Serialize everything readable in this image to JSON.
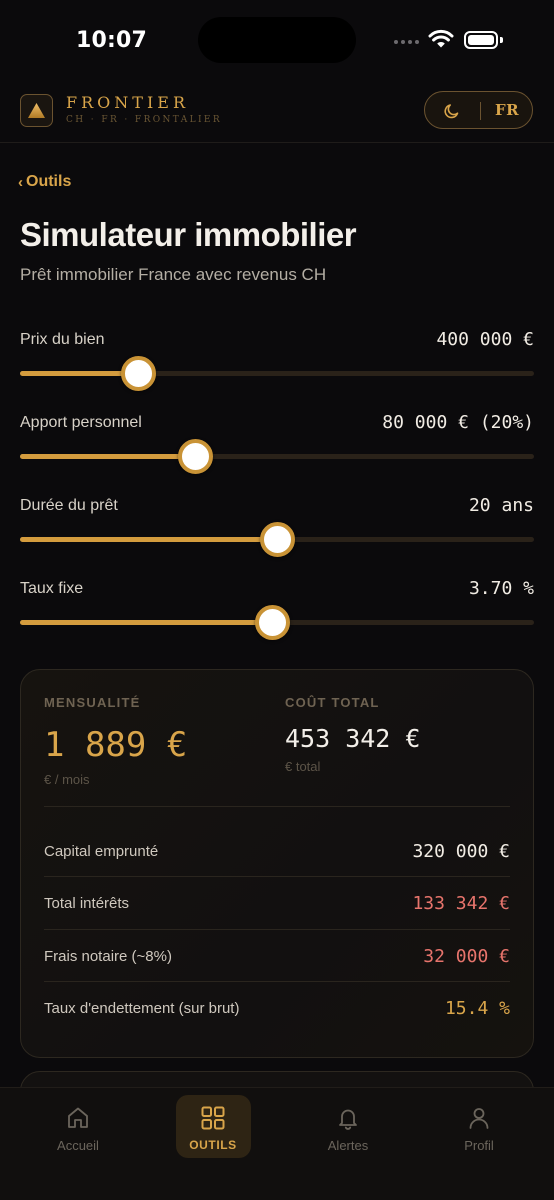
{
  "status_bar": {
    "time": "10:07"
  },
  "header": {
    "brand": "FRONTIER",
    "brand_sub": "CH · FR · FRONTALIER",
    "lang": "FR",
    "theme_icon": "moon-icon",
    "logo_icon": "triangle-logo-icon"
  },
  "nav_back": {
    "label": "Outils"
  },
  "page": {
    "title": "Simulateur immobilier",
    "subtitle": "Prêt immobilier France avec revenus CH"
  },
  "sliders": [
    {
      "label": "Prix du bien",
      "value": "400 000 €",
      "level": 0.23
    },
    {
      "label": "Apport personnel",
      "value": "80 000 € (20%)",
      "level": 0.34
    },
    {
      "label": "Durée du prêt",
      "value": "20 ans",
      "level": 0.5
    },
    {
      "label": "Taux fixe",
      "value": "3.70 %",
      "level": 0.49
    }
  ],
  "results": {
    "monthly_label": "MENSUALITÉ",
    "monthly_value": "1 889 €",
    "monthly_unit": "€ / mois",
    "total_label": "COÛT TOTAL",
    "total_value": "453 342 €",
    "total_unit": "€ total",
    "rows": [
      {
        "label": "Capital emprunté",
        "value": "320 000 €"
      },
      {
        "label": "Total intérêts",
        "value": "133 342 €"
      },
      {
        "label": "Frais notaire (~8%)",
        "value": "32 000 €"
      },
      {
        "label": "Taux d'endettement (sur brut)",
        "value": "15.4 %"
      }
    ]
  },
  "colors": {
    "accent": "#d9a54a",
    "negative": "#e7746c",
    "neutral": "#f1ece4",
    "background": "#0b0a0c"
  },
  "bottom_nav": [
    {
      "label": "Accueil",
      "icon": "home-icon"
    },
    {
      "label": "OUTILS",
      "icon": "grid-icon",
      "active": true
    },
    {
      "label": "Alertes",
      "icon": "bell-icon"
    },
    {
      "label": "Profil",
      "icon": "user-icon"
    }
  ]
}
